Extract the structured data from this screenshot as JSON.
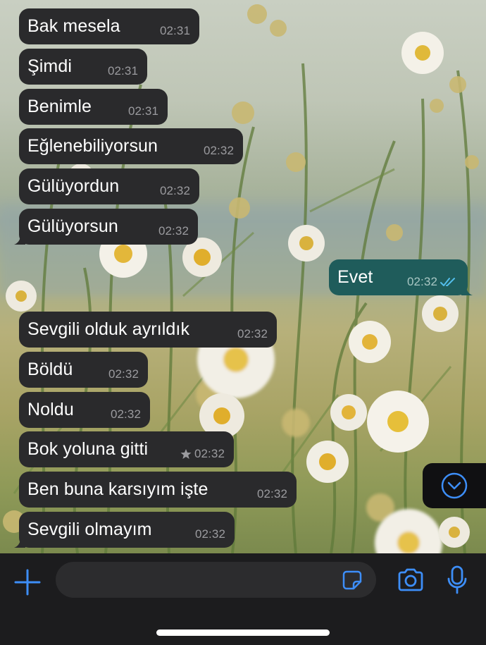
{
  "conversation": {
    "messages": [
      {
        "direction": "in",
        "text": "Bak mesela",
        "time": "02:31"
      },
      {
        "direction": "in",
        "text": "Şimdi",
        "time": "02:31"
      },
      {
        "direction": "in",
        "text": "Benimle",
        "time": "02:31"
      },
      {
        "direction": "in",
        "text": "Eğlenebiliyorsun",
        "time": "02:32"
      },
      {
        "direction": "in",
        "text": "Gülüyordun",
        "time": "02:32"
      },
      {
        "direction": "in",
        "text": "Gülüyorsun",
        "time": "02:32"
      },
      {
        "direction": "out",
        "text": "Evet",
        "time": "02:32",
        "status": "read"
      },
      {
        "direction": "in",
        "text": "Sevgili olduk ayrıldık",
        "time": "02:32"
      },
      {
        "direction": "in",
        "text": "Böldü",
        "time": "02:32"
      },
      {
        "direction": "in",
        "text": "Noldu",
        "time": "02:32"
      },
      {
        "direction": "in",
        "text": "Bok yoluna gitti",
        "time": "02:32",
        "starred": true
      },
      {
        "direction": "in",
        "text": "Ben buna karsıyım işte",
        "time": "02:32"
      },
      {
        "direction": "in",
        "text": "Sevgili olmayım",
        "time": "02:32"
      }
    ]
  },
  "composer": {
    "input_value": "",
    "input_placeholder": "",
    "icons": {
      "add": "plus-icon",
      "sticker": "sticker-icon",
      "camera": "camera-icon",
      "mic": "microphone-icon",
      "scroll_down": "chevron-down-icon",
      "starred": "star-icon",
      "read_receipt": "double-check-icon"
    }
  },
  "colors": {
    "incoming_bubble": "#2a2a2c",
    "outgoing_bubble": "#1f5c5b",
    "accent": "#3d8ef8",
    "read_tick": "#53bdeb",
    "bar_background": "#1c1c1e"
  }
}
